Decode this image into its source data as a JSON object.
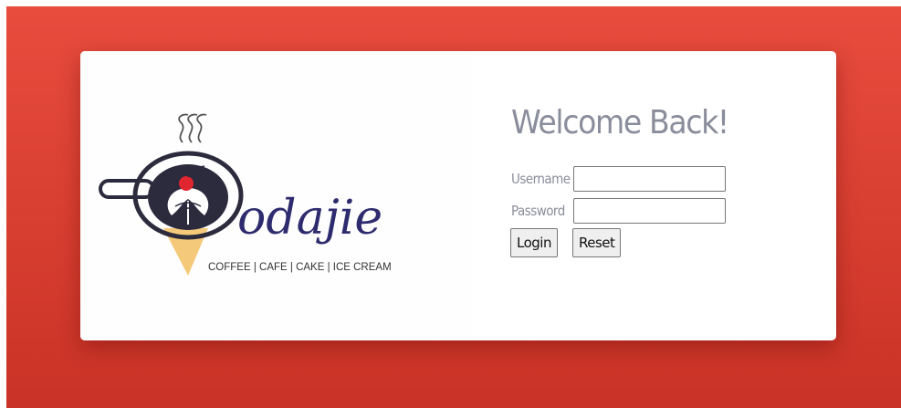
{
  "brand": {
    "name": "odajie",
    "tagline": "COFFEE | CAFE | CAKE | ICE CREAM",
    "colors": {
      "cup": "#2b2b3d",
      "wordmark": "#2e2c6e",
      "cherry": "#e0262f",
      "cone": "#f5c97a"
    }
  },
  "login": {
    "heading": "Welcome Back!",
    "username_label": "Username",
    "username_value": "",
    "password_label": "Password",
    "password_value": "",
    "login_button": "Login",
    "reset_button": "Reset"
  },
  "theme": {
    "background": "#e84c3d",
    "card": "#ffffff",
    "text_muted": "#8a8d9b"
  }
}
